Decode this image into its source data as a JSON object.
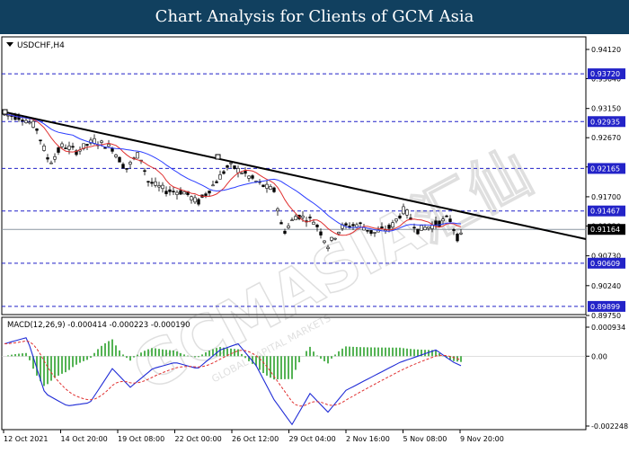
{
  "header": {
    "title": "Chart Analysis for Clients of GCM Asia"
  },
  "main_chart": {
    "symbol_label": "USDCHF,H4",
    "price_axis_ticks": [
      "0.94120",
      "0.93640",
      "0.93150",
      "0.92670",
      "0.92190",
      "0.91700",
      "0.91220",
      "0.90730",
      "0.90240",
      "0.89750"
    ],
    "levels": [
      {
        "label": "0.93720",
        "value": 0.9372
      },
      {
        "label": "0.92935",
        "value": 0.92935
      },
      {
        "label": "0.92165",
        "value": 0.92165
      },
      {
        "label": "0.91467",
        "value": 0.91467
      },
      {
        "label": "0.90609",
        "value": 0.90609
      },
      {
        "label": "0.89899",
        "value": 0.89899
      }
    ],
    "current_price_label": "0.91164",
    "current_price": 0.91164,
    "colors": {
      "level_line": "#2020c8",
      "level_box": "#2323c8",
      "current_box": "#000000",
      "trendline": "#000000",
      "ma_fast": "#e03030",
      "ma_slow": "#2a3cff"
    }
  },
  "macd_panel": {
    "label": "MACD(12,26,9) -0.000414 -0.000223 -0.000190",
    "axis_ticks": [
      "0.000934",
      "0.00",
      "-0.002248"
    ]
  },
  "time_axis": {
    "labels": [
      "12 Oct 2021",
      "14 Oct 20:00",
      "19 Oct 08:00",
      "22 Oct 00:00",
      "26 Oct 12:00",
      "29 Oct 04:00",
      "2 Nov 16:00",
      "5 Nov 08:00",
      "9 Nov 20:00"
    ]
  },
  "watermark": {
    "text": "GCMASIA汇仙",
    "subtext": "GLOBAL CAPITAL MARKETS"
  }
}
